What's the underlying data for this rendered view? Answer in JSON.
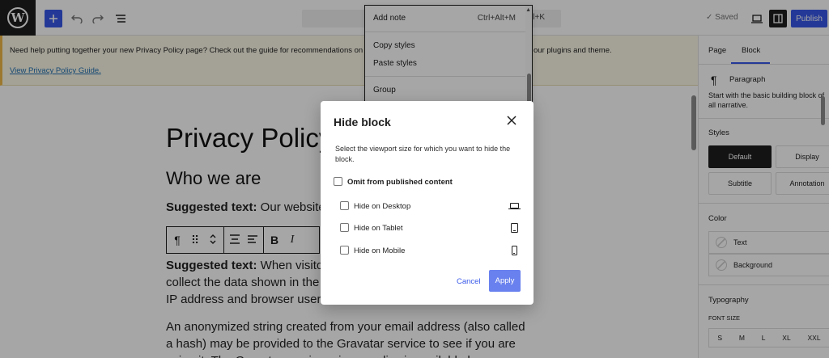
{
  "topbar": {
    "logo_text": "W",
    "add_icon": "plus-icon",
    "undo_icon": "undo-icon",
    "redo_icon": "redo-icon",
    "list_icon": "list-view-icon",
    "shortcut_fragment": "l+K",
    "saved_label": "✓ Saved",
    "publish_label": "Publish"
  },
  "notice": {
    "text_start": "Need help putting together your new Privacy Policy page? Check out the guide for recommendations on what c",
    "text_end": "our plugins and theme.",
    "link": "View Privacy Policy Guide."
  },
  "canvas": {
    "title": "Privacy Policy",
    "heading": "Who we are",
    "p1_label": "Suggested text:",
    "p1_text": " Our website",
    "p2_label": "Suggested text:",
    "p2_text": " When visito collect the data shown in the IP address and browser user",
    "p3_text": "An anonymized string created from your email address (also called a hash) may be provided to the Gravatar service to see if you are using it. The Gravatar service privacy policy is available here"
  },
  "block_toolbar": {
    "paragraph_icon": "¶",
    "drag_icon": "⠿",
    "move_icon": "⌃",
    "align_icon": "≡",
    "text_align_icon": "☰",
    "bold": "B",
    "italic": "I"
  },
  "dropdown": {
    "items": [
      {
        "label": "Add note",
        "shortcut": "Ctrl+Alt+M"
      },
      {
        "label": "Copy styles"
      },
      {
        "label": "Paste styles"
      },
      {
        "label": "Group"
      }
    ]
  },
  "modal": {
    "title": "Hide block",
    "description": "Select the viewport size for which you want to hide the block.",
    "omit_label": "Omit from published content",
    "options": [
      {
        "label": "Hide on Desktop",
        "icon": "desktop-icon"
      },
      {
        "label": "Hide on Tablet",
        "icon": "tablet-icon"
      },
      {
        "label": "Hide on Mobile",
        "icon": "mobile-icon"
      }
    ],
    "cancel_label": "Cancel",
    "apply_label": "Apply"
  },
  "sidebar": {
    "tab_page": "Page",
    "tab_block": "Block",
    "block_name": "Paragraph",
    "block_desc": "Start with the basic building block of all narrative.",
    "styles_heading": "Styles",
    "styles": [
      "Default",
      "Display",
      "Subtitle",
      "Annotation"
    ],
    "color_heading": "Color",
    "colors": [
      "Text",
      "Background"
    ],
    "typography_heading": "Typography",
    "font_size_label": "FONT SIZE",
    "font_sizes": [
      "S",
      "M",
      "L",
      "XL",
      "XXL"
    ]
  },
  "colors": {
    "accent": "#3858e9",
    "dark": "#1e1e1e",
    "notice_bg": "#fcf9e8"
  }
}
